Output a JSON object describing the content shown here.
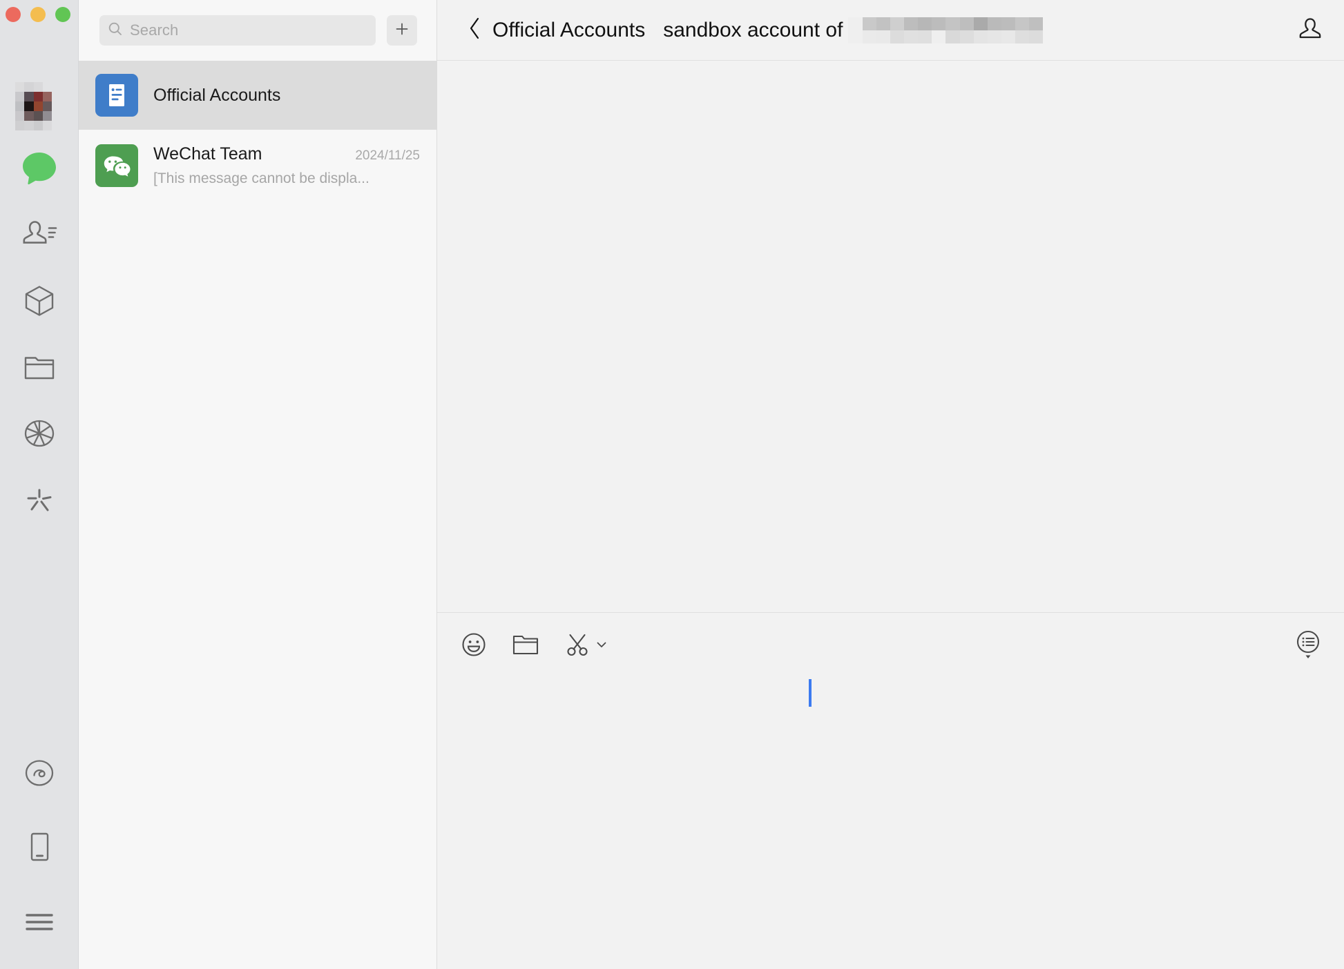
{
  "window": {
    "controls": [
      {
        "name": "close",
        "color": "#ec6a5e"
      },
      {
        "name": "minimize",
        "color": "#f4bd4f"
      },
      {
        "name": "zoom",
        "color": "#61c554"
      }
    ]
  },
  "rail": {
    "avatar_label": "user-avatar",
    "avatar_mosaic": [
      "#e2e3e5",
      "#dcdcdd",
      "#d4d4d6",
      "#d9d9db",
      "#e2e3e5",
      "#e2e3e5",
      "#c9c9cc",
      "#574c53",
      "#7d2f2f",
      "#96645f",
      "#e2e3e5",
      "#bfc0c3",
      "#1e1616",
      "#92452f",
      "#65585a",
      "#e2e3e5",
      "#c9c8cb",
      "#6f5c5d",
      "#5b5152",
      "#918d92",
      "#e2e3e5",
      "#cfcfd1",
      "#d2d2d4",
      "#cbcbcd",
      "#dadadc"
    ],
    "items": [
      {
        "icon": "chat-bubble-icon",
        "label": "Chats",
        "active": true
      },
      {
        "icon": "contacts-icon",
        "label": "Contacts",
        "active": false
      },
      {
        "icon": "cube-icon",
        "label": "Mini Programs Panel",
        "active": false
      },
      {
        "icon": "folder-icon",
        "label": "Files",
        "active": false
      },
      {
        "icon": "aperture-icon",
        "label": "Moments",
        "active": false
      },
      {
        "icon": "sparkle-icon",
        "label": "Top Stories",
        "active": false
      }
    ],
    "bottom_items": [
      {
        "icon": "mini-program-icon",
        "label": "Mini Programs"
      },
      {
        "icon": "phone-icon",
        "label": "Phone"
      },
      {
        "icon": "hamburger-menu-icon",
        "label": "More"
      }
    ]
  },
  "search": {
    "placeholder": "Search",
    "icon": "search-icon",
    "add_icon": "plus-icon",
    "add_label": "New Chat"
  },
  "chat_list": [
    {
      "name": "Official Accounts",
      "avatar_icon": "official-accounts-icon",
      "avatar_color": "#3f7dc9",
      "time": "",
      "preview": "",
      "selected": true
    },
    {
      "name": "WeChat Team",
      "avatar_icon": "wechat-logo-icon",
      "avatar_color": "#4e9e51",
      "time": "2024/11/25",
      "preview": "[This message cannot be displa...",
      "selected": false
    }
  ],
  "header": {
    "back_icon": "chevron-left-icon",
    "back_label": "Official Accounts",
    "title": "sandbox account of",
    "redacted_label": "redacted-account-name",
    "redacted_mosaic": [
      "#efefef",
      "#c9c9c9",
      "#c2c2c2",
      "#cfcfcf",
      "#bdbdbd",
      "#b7b7b7",
      "#bcbcbc",
      "#c4c4c4",
      "#bebebe",
      "#aaaaaa",
      "#bababa",
      "#bcbcbc",
      "#c6c6c6",
      "#bfbfbf",
      "#efefef",
      "#eaeaea",
      "#e9e9e9",
      "#dcdcdc",
      "#e0e0e0",
      "#dfdfdf",
      "#efefef",
      "#d9d9d9",
      "#dddddd",
      "#e4e4e4",
      "#e6e6e6",
      "#e8e8e8",
      "#dedede",
      "#dcdcdc"
    ],
    "profile_icon": "person-icon",
    "profile_label": "Contact Info"
  },
  "composer": {
    "tools": [
      {
        "icon": "emoji-icon",
        "label": "Sticker"
      },
      {
        "icon": "folder-icon",
        "label": "Send File"
      },
      {
        "icon": "scissors-icon",
        "label": "Screenshot",
        "has_chevron": true
      }
    ],
    "right_tool": {
      "icon": "history-list-icon",
      "label": "Chat History"
    },
    "input_value": "",
    "caret_visible": true,
    "caret_color": "#3c7bf0"
  },
  "colors": {
    "rail_bg": "#e2e3e5",
    "list_bg": "#f7f7f7",
    "selected_row": "#dcdcdc",
    "main_bg": "#f2f2f2",
    "icon_gray": "#6e6e6e",
    "text_primary": "#1a1a1a",
    "text_muted": "#a6a6a6",
    "accent_blue": "#3c7bf0",
    "wechat_green": "#4e9e51"
  }
}
